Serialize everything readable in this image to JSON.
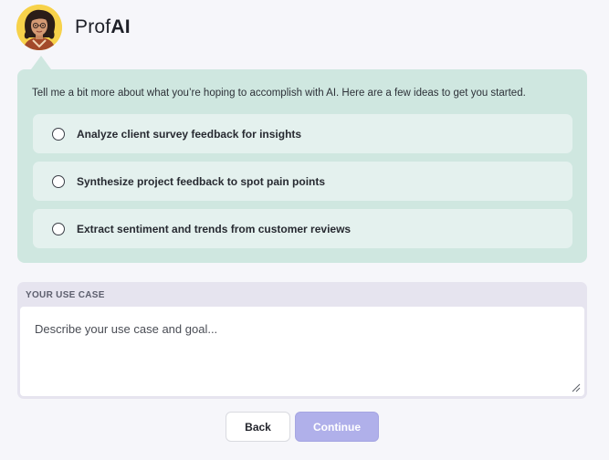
{
  "header": {
    "brand_prefix": "Prof",
    "brand_suffix": "AI",
    "avatar_icon": "woman-avatar-icon"
  },
  "prompt": {
    "intro": "Tell me a bit more about what you’re hoping to accomplish with AI. Here are a few ideas to get you started.",
    "options": [
      {
        "label": "Analyze client survey feedback for insights",
        "selected": false
      },
      {
        "label": "Synthesize project feedback to spot pain points",
        "selected": false
      },
      {
        "label": "Extract sentiment and trends from customer reviews",
        "selected": false
      }
    ]
  },
  "use_case": {
    "label": "YOUR USE CASE",
    "placeholder": "Describe your use case and goal...",
    "value": ""
  },
  "actions": {
    "back_label": "Back",
    "continue_label": "Continue",
    "continue_enabled": false
  },
  "colors": {
    "page_bg": "#f6f6fa",
    "prompt_bg": "#cfe7e0",
    "option_bg": "#e4f1ee",
    "usecase_bg": "#e6e4ef",
    "continue_disabled": "#b0b0ea",
    "avatar_bg": "#f7d24a"
  }
}
